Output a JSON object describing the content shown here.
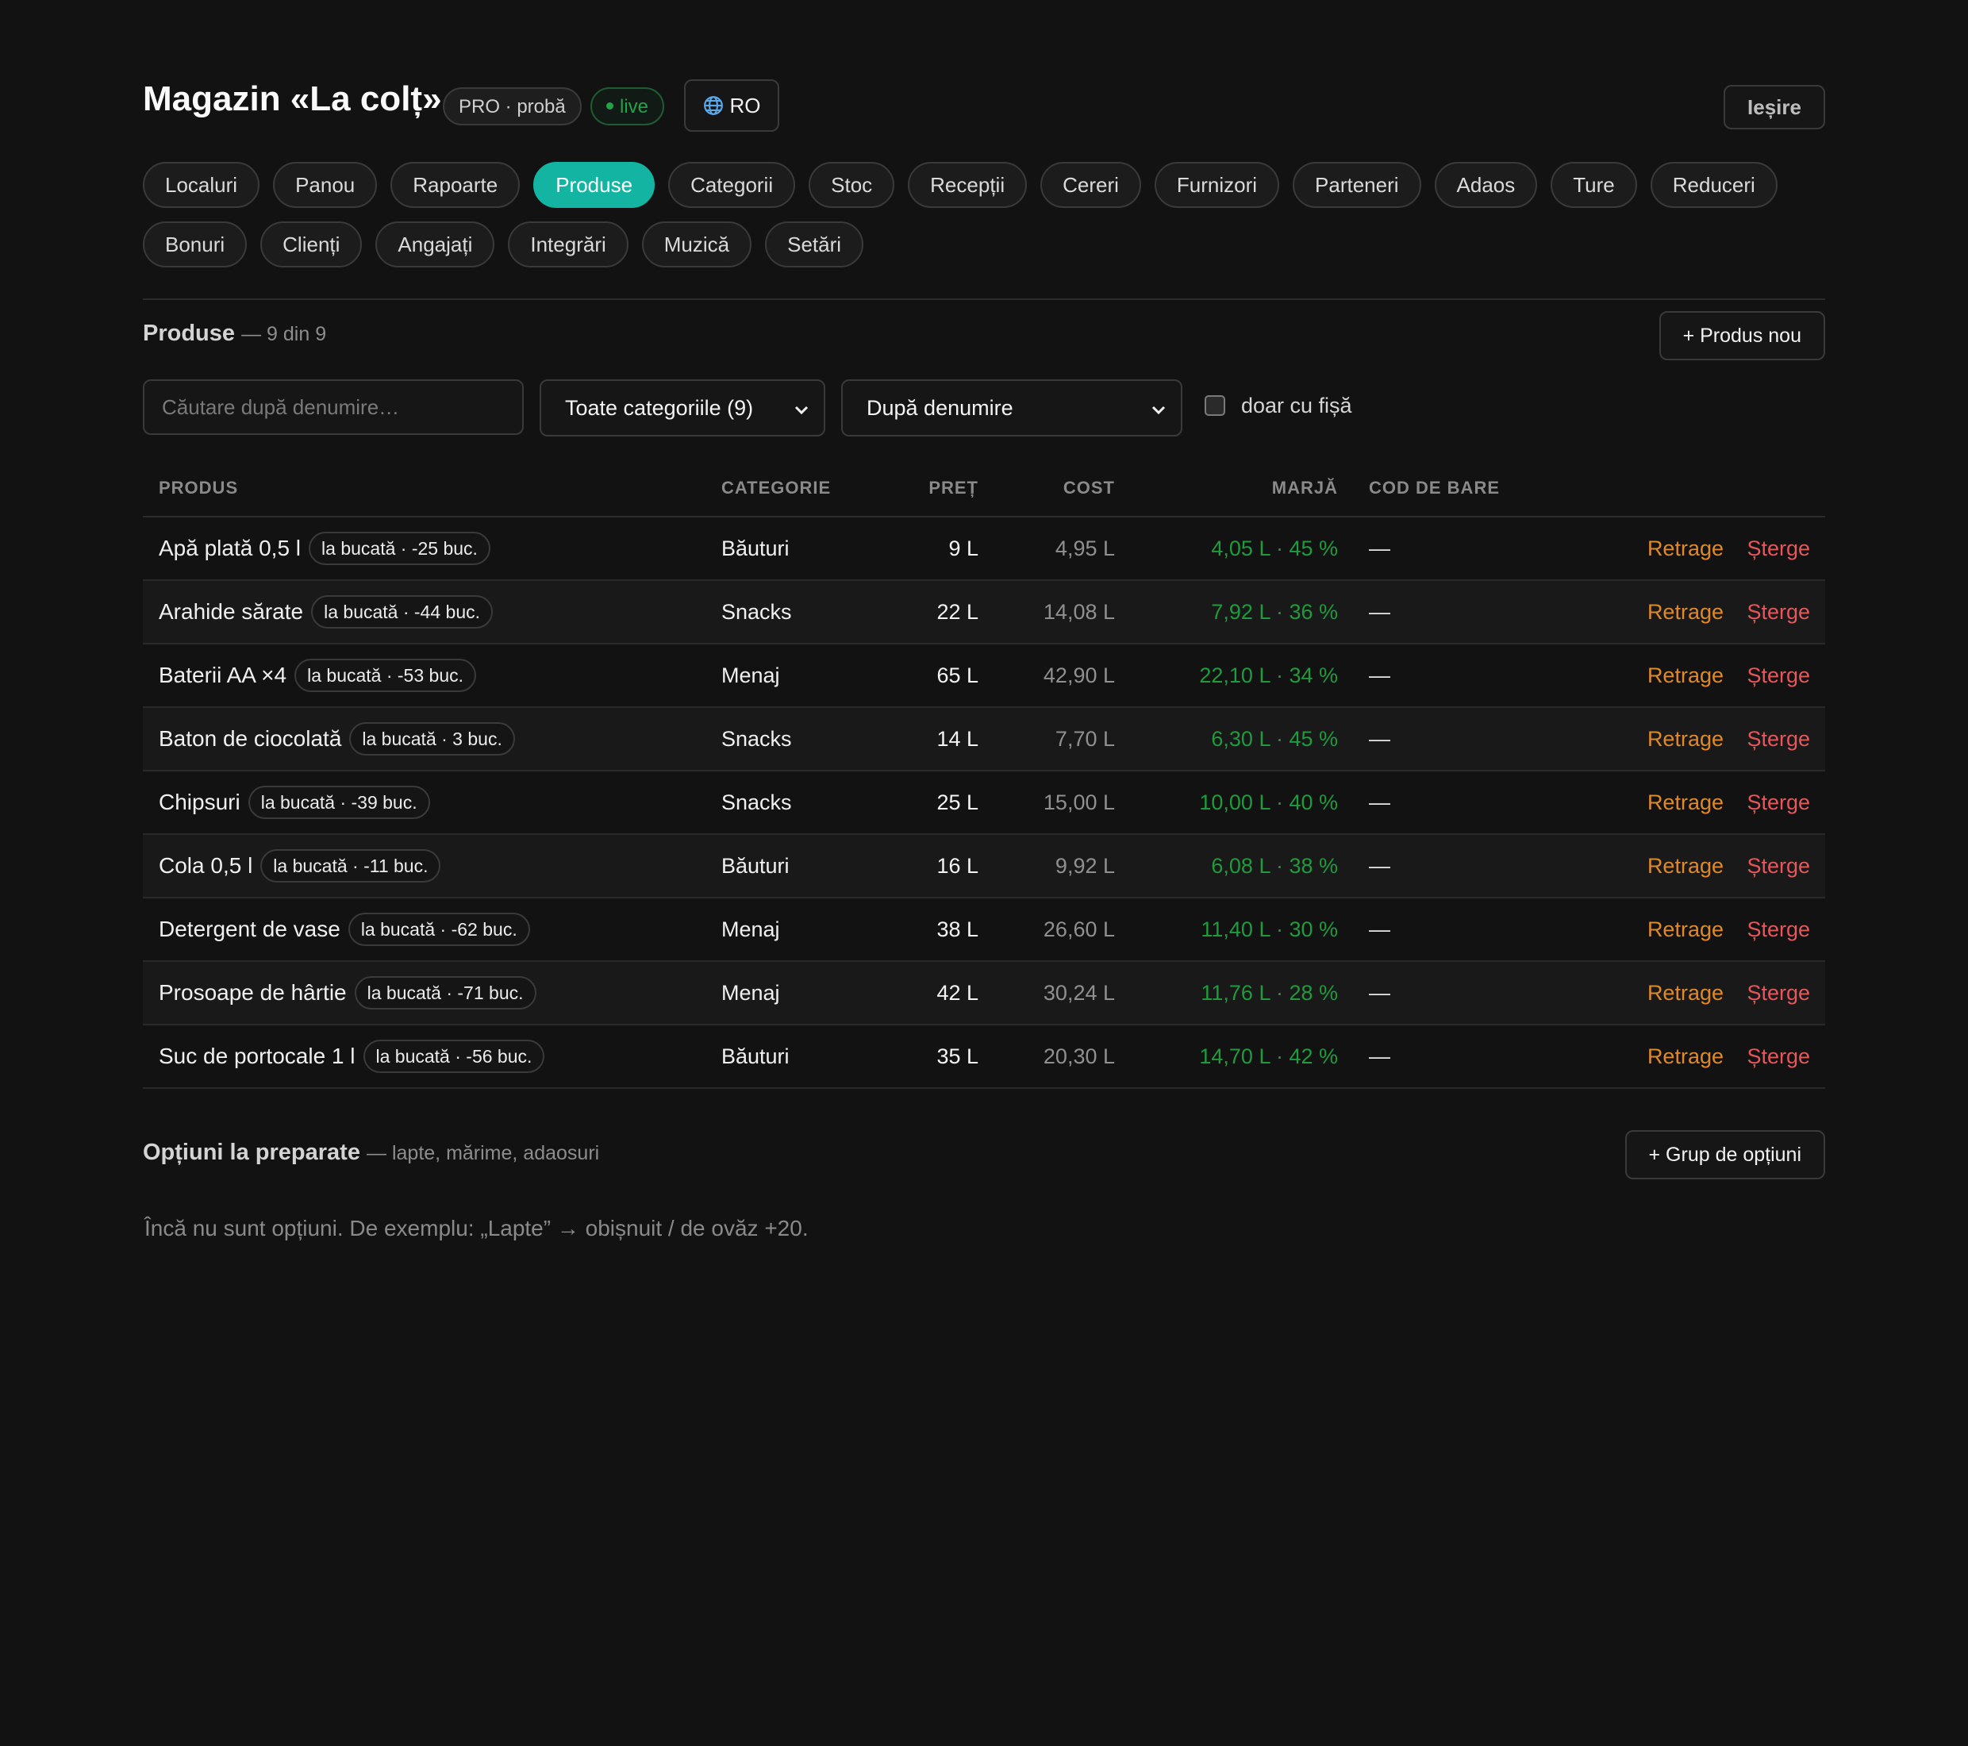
{
  "header": {
    "title": "Magazin «La colț»",
    "plan_badge": "PRO · probă",
    "live_badge": "live",
    "language": "RO",
    "logout_label": "Ieșire",
    "colors": {
      "accent": "#13b5a2",
      "live": "#22a34a",
      "margin": "#1f9a3c",
      "retract": "#de8a2a",
      "delete": "#e6575b"
    }
  },
  "nav": {
    "row1": [
      "Localuri",
      "Panou",
      "Rapoarte",
      "Produse",
      "Categorii",
      "Stoc",
      "Recepții",
      "Cereri",
      "Furnizori",
      "Parteneri",
      "Adaos",
      "Ture",
      "Reduceri"
    ],
    "row2": [
      "Bonuri",
      "Clienți",
      "Angajați",
      "Integrări",
      "Muzică",
      "Setări"
    ],
    "active": "Produse"
  },
  "products": {
    "title": "Produse",
    "count": "— 9 din 9",
    "new_button": "+ Produs nou",
    "search_placeholder": "Căutare după denumire…",
    "category_filter": "Toate categoriile (9)",
    "sort": "După denumire",
    "only_with_card_label": "doar cu fișă",
    "only_with_card_checked": false,
    "columns": {
      "product": "PRODUS",
      "category": "CATEGORIE",
      "price": "PREȚ",
      "cost": "COST",
      "margin": "MARJĂ",
      "barcode": "COD DE BARE"
    },
    "retract_label": "Retrage",
    "delete_label": "Șterge",
    "rows": [
      {
        "name": "Apă plată 0,5 l",
        "unit": "la bucată · -25 buc.",
        "category": "Băuturi",
        "price": "9 L",
        "cost": "4,95 L",
        "margin": "4,05 L · 45 %",
        "barcode": "—"
      },
      {
        "name": "Arahide sărate",
        "unit": "la bucată · -44 buc.",
        "category": "Snacks",
        "price": "22 L",
        "cost": "14,08 L",
        "margin": "7,92 L · 36 %",
        "barcode": "—"
      },
      {
        "name": "Baterii AA ×4",
        "unit": "la bucată · -53 buc.",
        "category": "Menaj",
        "price": "65 L",
        "cost": "42,90 L",
        "margin": "22,10 L · 34 %",
        "barcode": "—"
      },
      {
        "name": "Baton de ciocolată",
        "unit": "la bucată · 3 buc.",
        "category": "Snacks",
        "price": "14 L",
        "cost": "7,70 L",
        "margin": "6,30 L · 45 %",
        "barcode": "—"
      },
      {
        "name": "Chipsuri",
        "unit": "la bucată · -39 buc.",
        "category": "Snacks",
        "price": "25 L",
        "cost": "15,00 L",
        "margin": "10,00 L · 40 %",
        "barcode": "—"
      },
      {
        "name": "Cola 0,5 l",
        "unit": "la bucată · -11 buc.",
        "category": "Băuturi",
        "price": "16 L",
        "cost": "9,92 L",
        "margin": "6,08 L · 38 %",
        "barcode": "—"
      },
      {
        "name": "Detergent de vase",
        "unit": "la bucată · -62 buc.",
        "category": "Menaj",
        "price": "38 L",
        "cost": "26,60 L",
        "margin": "11,40 L · 30 %",
        "barcode": "—"
      },
      {
        "name": "Prosoape de hârtie",
        "unit": "la bucată · -71 buc.",
        "category": "Menaj",
        "price": "42 L",
        "cost": "30,24 L",
        "margin": "11,76 L · 28 %",
        "barcode": "—"
      },
      {
        "name": "Suc de portocale 1 l",
        "unit": "la bucată · -56 buc.",
        "category": "Băuturi",
        "price": "35 L",
        "cost": "20,30 L",
        "margin": "14,70 L · 42 %",
        "barcode": "—"
      }
    ]
  },
  "options": {
    "title": "Opțiuni la preparate",
    "subtitle": "— lapte, mărime, adaosuri",
    "add_button": "+ Grup de opțiuni",
    "empty_text": "Încă nu sunt opțiuni. De exemplu: „Lapte” → obișnuit / de ovăz +20."
  }
}
